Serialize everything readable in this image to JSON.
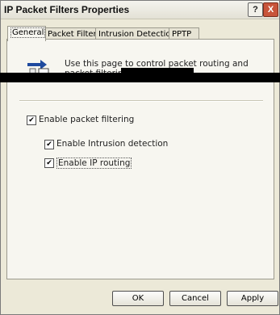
{
  "window": {
    "title": "IP Packet Filters Properties",
    "help_label": "?",
    "close_label": "X"
  },
  "tabs": [
    {
      "label": "General"
    },
    {
      "label": "Packet Filters"
    },
    {
      "label": "Intrusion Detection"
    },
    {
      "label": "PPTP"
    }
  ],
  "general": {
    "intro_text": "Use this page to control packet routing and packet filtering properties.",
    "options": [
      {
        "label": "Enable packet filtering",
        "checked": true
      },
      {
        "label": "Enable Intrusion detection",
        "checked": true
      },
      {
        "label": "Enable IP routing",
        "checked": true
      }
    ],
    "check_mark": "✔"
  },
  "buttons": {
    "ok": "OK",
    "cancel": "Cancel",
    "apply": "Apply"
  }
}
